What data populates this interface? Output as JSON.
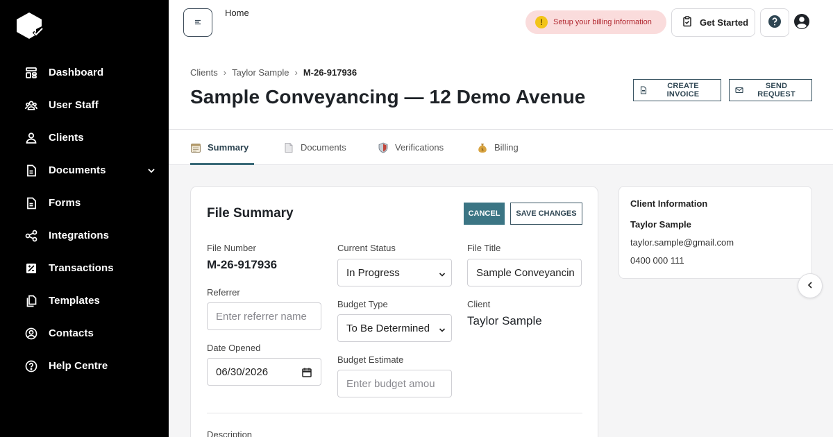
{
  "sidebar": {
    "items": [
      {
        "label": "Dashboard",
        "icon": "dashboard-icon"
      },
      {
        "label": "User Staff",
        "icon": "users-icon"
      },
      {
        "label": "Clients",
        "icon": "clients-icon"
      },
      {
        "label": "Documents",
        "icon": "document-icon",
        "expandable": true
      },
      {
        "label": "Forms",
        "icon": "form-icon"
      },
      {
        "label": "Integrations",
        "icon": "share-icon"
      },
      {
        "label": "Transactions",
        "icon": "transactions-icon"
      },
      {
        "label": "Templates",
        "icon": "templates-icon"
      },
      {
        "label": "Contacts",
        "icon": "contacts-icon"
      },
      {
        "label": "Help Centre",
        "icon": "help-circle-icon"
      }
    ]
  },
  "header": {
    "home_label": "Home",
    "billing_notice": "Setup your billing information",
    "get_started_label": "Get Started"
  },
  "breadcrumb": {
    "items": [
      "Clients",
      "Taylor Sample",
      "M-26-917936"
    ]
  },
  "page": {
    "title": "Sample Conveyancing — 12 Demo Avenue",
    "create_invoice_label": "CREATE INVOICE",
    "send_request_label": "SEND REQUEST"
  },
  "tabs": [
    {
      "label": "Summary",
      "active": true
    },
    {
      "label": "Documents",
      "active": false
    },
    {
      "label": "Verifications",
      "active": false
    },
    {
      "label": "Billing",
      "active": false
    }
  ],
  "file_summary": {
    "title": "File Summary",
    "cancel_label": "CANCEL",
    "save_label": "SAVE CHANGES",
    "file_number_label": "File Number",
    "file_number": "M-26-917936",
    "referrer_label": "Referrer",
    "referrer_placeholder": "Enter referrer name",
    "date_opened_label": "Date Opened",
    "date_opened": "06/30/2026",
    "current_status_label": "Current Status",
    "current_status": "In Progress",
    "budget_type_label": "Budget Type",
    "budget_type": "To Be Determined",
    "budget_estimate_label": "Budget Estimate",
    "budget_estimate_placeholder": "Enter budget amou",
    "file_title_label": "File Title",
    "file_title": "Sample Conveyancin",
    "client_label": "Client",
    "client": "Taylor Sample",
    "description_label": "Description"
  },
  "client_info": {
    "title": "Client Information",
    "name": "Taylor Sample",
    "email": "taylor.sample@gmail.com",
    "phone": "0400 000 111"
  }
}
